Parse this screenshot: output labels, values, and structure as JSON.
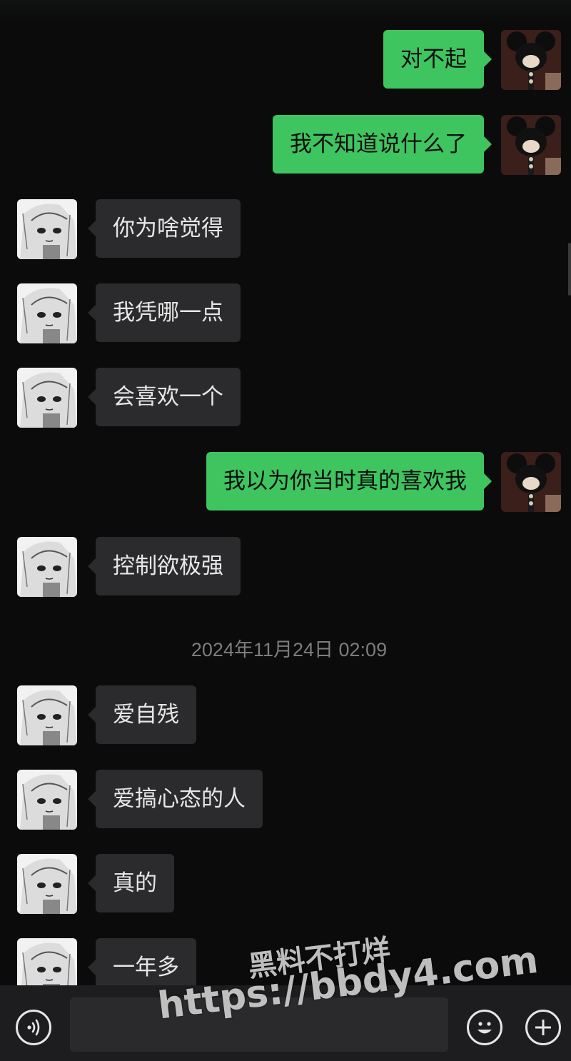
{
  "messages": [
    {
      "side": "out",
      "text": "对不起"
    },
    {
      "side": "out",
      "text": "我不知道说什么了"
    },
    {
      "side": "in",
      "text": "你为啥觉得"
    },
    {
      "side": "in",
      "text": "我凭哪一点"
    },
    {
      "side": "in",
      "text": "会喜欢一个"
    },
    {
      "side": "out",
      "text": "我以为你当时真的喜欢我"
    },
    {
      "side": "in",
      "text": "控制欲极强"
    },
    {
      "side": "in",
      "text": "爱自残"
    },
    {
      "side": "in",
      "text": "爱搞心态的人"
    },
    {
      "side": "in",
      "text": "真的"
    },
    {
      "side": "in",
      "text": "一年多"
    }
  ],
  "timestamp": "2024年11月24日 02:09",
  "bottom_bar": {
    "voice_icon": "voice-icon",
    "emoji_icon": "emoji-icon",
    "plus_icon": "plus-icon"
  },
  "watermark": {
    "line1": "黑料不打烊",
    "line2": "https://bbdy4.com"
  },
  "colors": {
    "background": "#0b0b0c",
    "outgoing_bubble": "#3ec55f",
    "incoming_bubble": "#2b2b2d",
    "incoming_text": "#e6e6e6",
    "outgoing_text": "#0e0e0e",
    "timestamp": "#7d7d7d"
  }
}
